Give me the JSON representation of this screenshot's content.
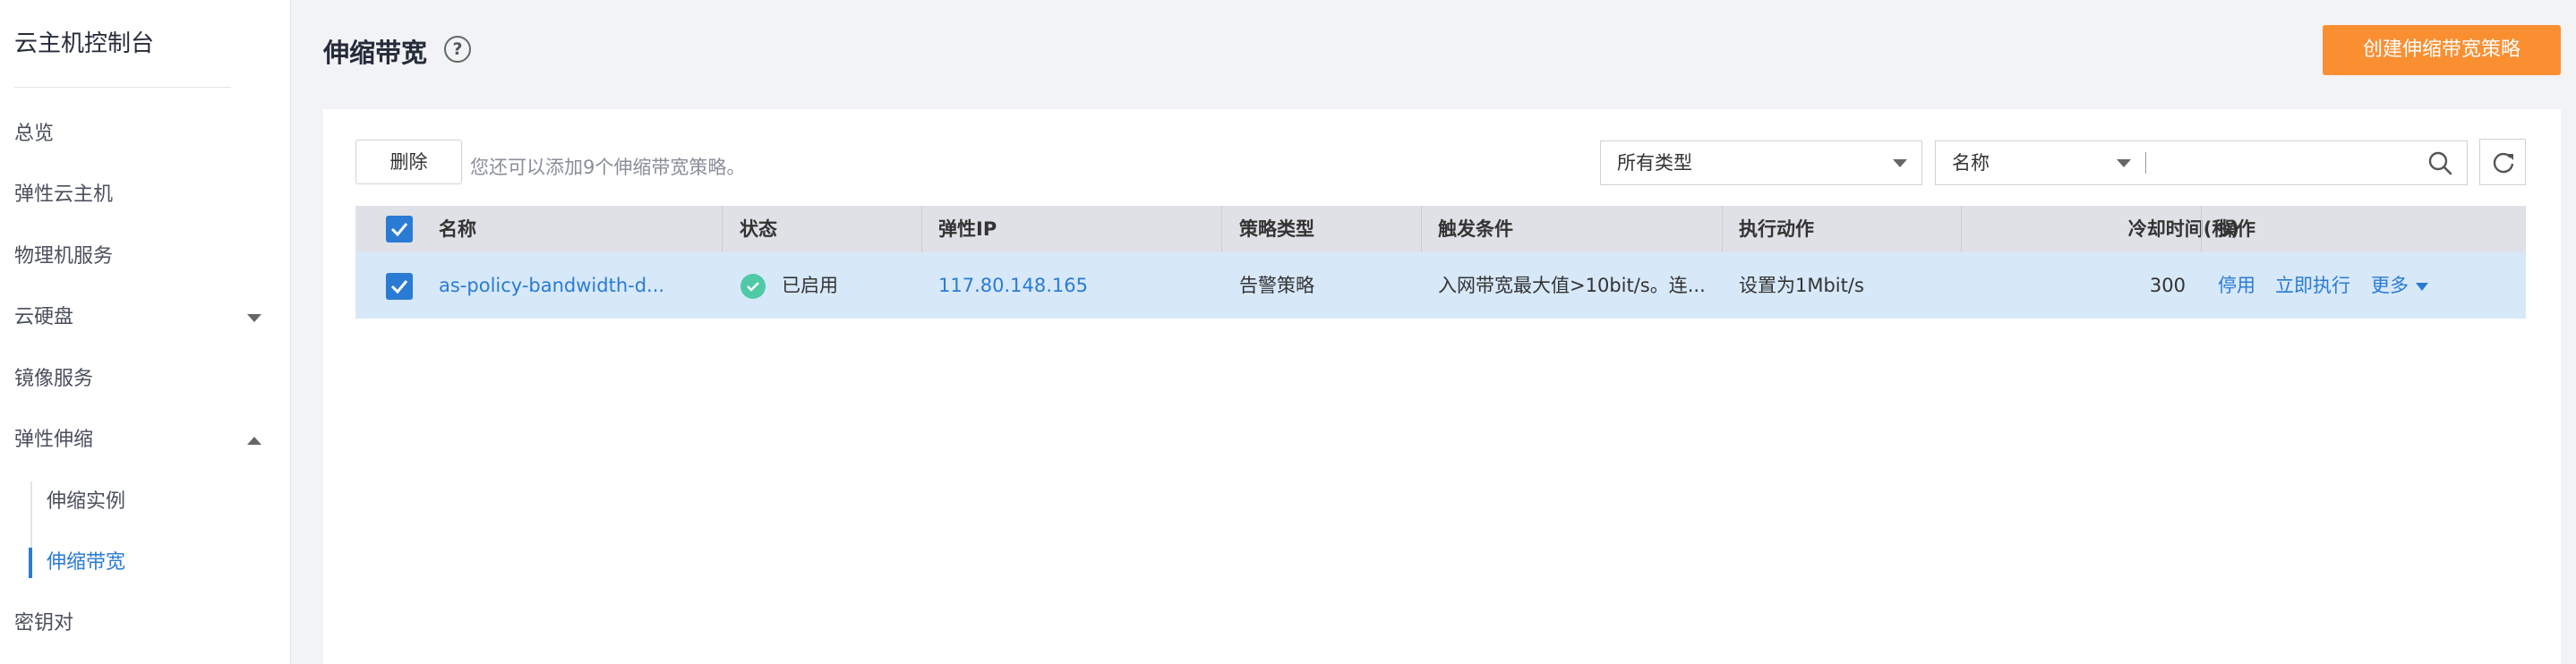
{
  "sidebar": {
    "title": "云主机控制台",
    "items": [
      {
        "label": "总览"
      },
      {
        "label": "弹性云主机"
      },
      {
        "label": "物理机服务"
      },
      {
        "label": "云硬盘"
      },
      {
        "label": "镜像服务"
      },
      {
        "label": "弹性伸缩"
      },
      {
        "label": "伸缩实例"
      },
      {
        "label": "伸缩带宽"
      },
      {
        "label": "密钥对"
      }
    ]
  },
  "header": {
    "title": "伸缩带宽",
    "help": "?",
    "create_label": "创建伸缩带宽策略"
  },
  "toolbar": {
    "delete_label": "删除",
    "tip": "您还可以添加9个伸缩带宽策略。",
    "type_select": "所有类型",
    "field_select": "名称",
    "search_value": ""
  },
  "table": {
    "headers": [
      "名称",
      "状态",
      "弹性IP",
      "策略类型",
      "触发条件",
      "执行动作",
      "冷却时间(秒)",
      "操作"
    ],
    "rows": [
      {
        "name": "as-policy-bandwidth-d...",
        "status": "已启用",
        "eip": "117.80.148.165",
        "policy_type": "告警策略",
        "trigger": "入网带宽最大值>10bit/s。连...",
        "action": "设置为1Mbit/s",
        "cooldown": "300",
        "ops": [
          "停用",
          "立即执行",
          "更多"
        ]
      }
    ]
  },
  "colors": {
    "accent": "#2a7bd3",
    "create_button": "#fa8f32",
    "status_ok": "#50c9a6",
    "selected_row": "#d7e8f9"
  },
  "icons": [
    "help-icon",
    "search-icon",
    "refresh-icon",
    "chevron-down-icon",
    "chevron-up-icon",
    "check-icon",
    "status-enabled-icon"
  ]
}
